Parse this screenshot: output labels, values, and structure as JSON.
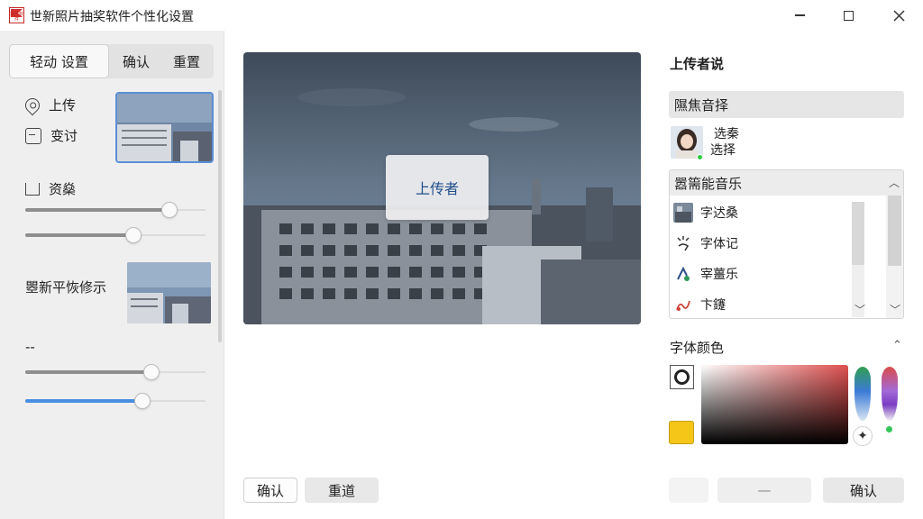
{
  "window": {
    "title": "世新照片抽奖软件个性化设置",
    "app_icon_text": "抽奖软件"
  },
  "sidebar": {
    "tabs": [
      {
        "label": "轻动  设置"
      },
      {
        "label": "确认"
      },
      {
        "label": "重置"
      }
    ],
    "items": [
      {
        "label": "上传",
        "icon": "pin-icon"
      },
      {
        "label": "变讨",
        "icon": "box-icon"
      },
      {
        "label": "资燊",
        "icon": "bracket-icon"
      }
    ],
    "background_label": "瞾新平恢修示",
    "dash_label": "--",
    "sliders": [
      {
        "value": 0.8
      },
      {
        "value": 0.6
      },
      {
        "value": 0.7
      },
      {
        "value": 0.65
      }
    ]
  },
  "preview": {
    "button_label": "上传者"
  },
  "bottom": {
    "confirm_label": "确认",
    "reset_label": "重道",
    "right_dash_label": "—",
    "right_confirm_label": "确认"
  },
  "right_panel": {
    "title": "上传者说",
    "select_head": "隰焦音择",
    "user_line1": "选秦",
    "user_line2": "选择",
    "music_head": "嚣篅能音乐",
    "music_items": [
      {
        "label": "字迖桑"
      },
      {
        "label": "字体记"
      },
      {
        "label": "宰薑乐"
      },
      {
        "label": "卞鑳"
      }
    ],
    "font_color_title": "字体颜色",
    "selected_color": "#f5c518",
    "hue_color": "#e05050"
  }
}
